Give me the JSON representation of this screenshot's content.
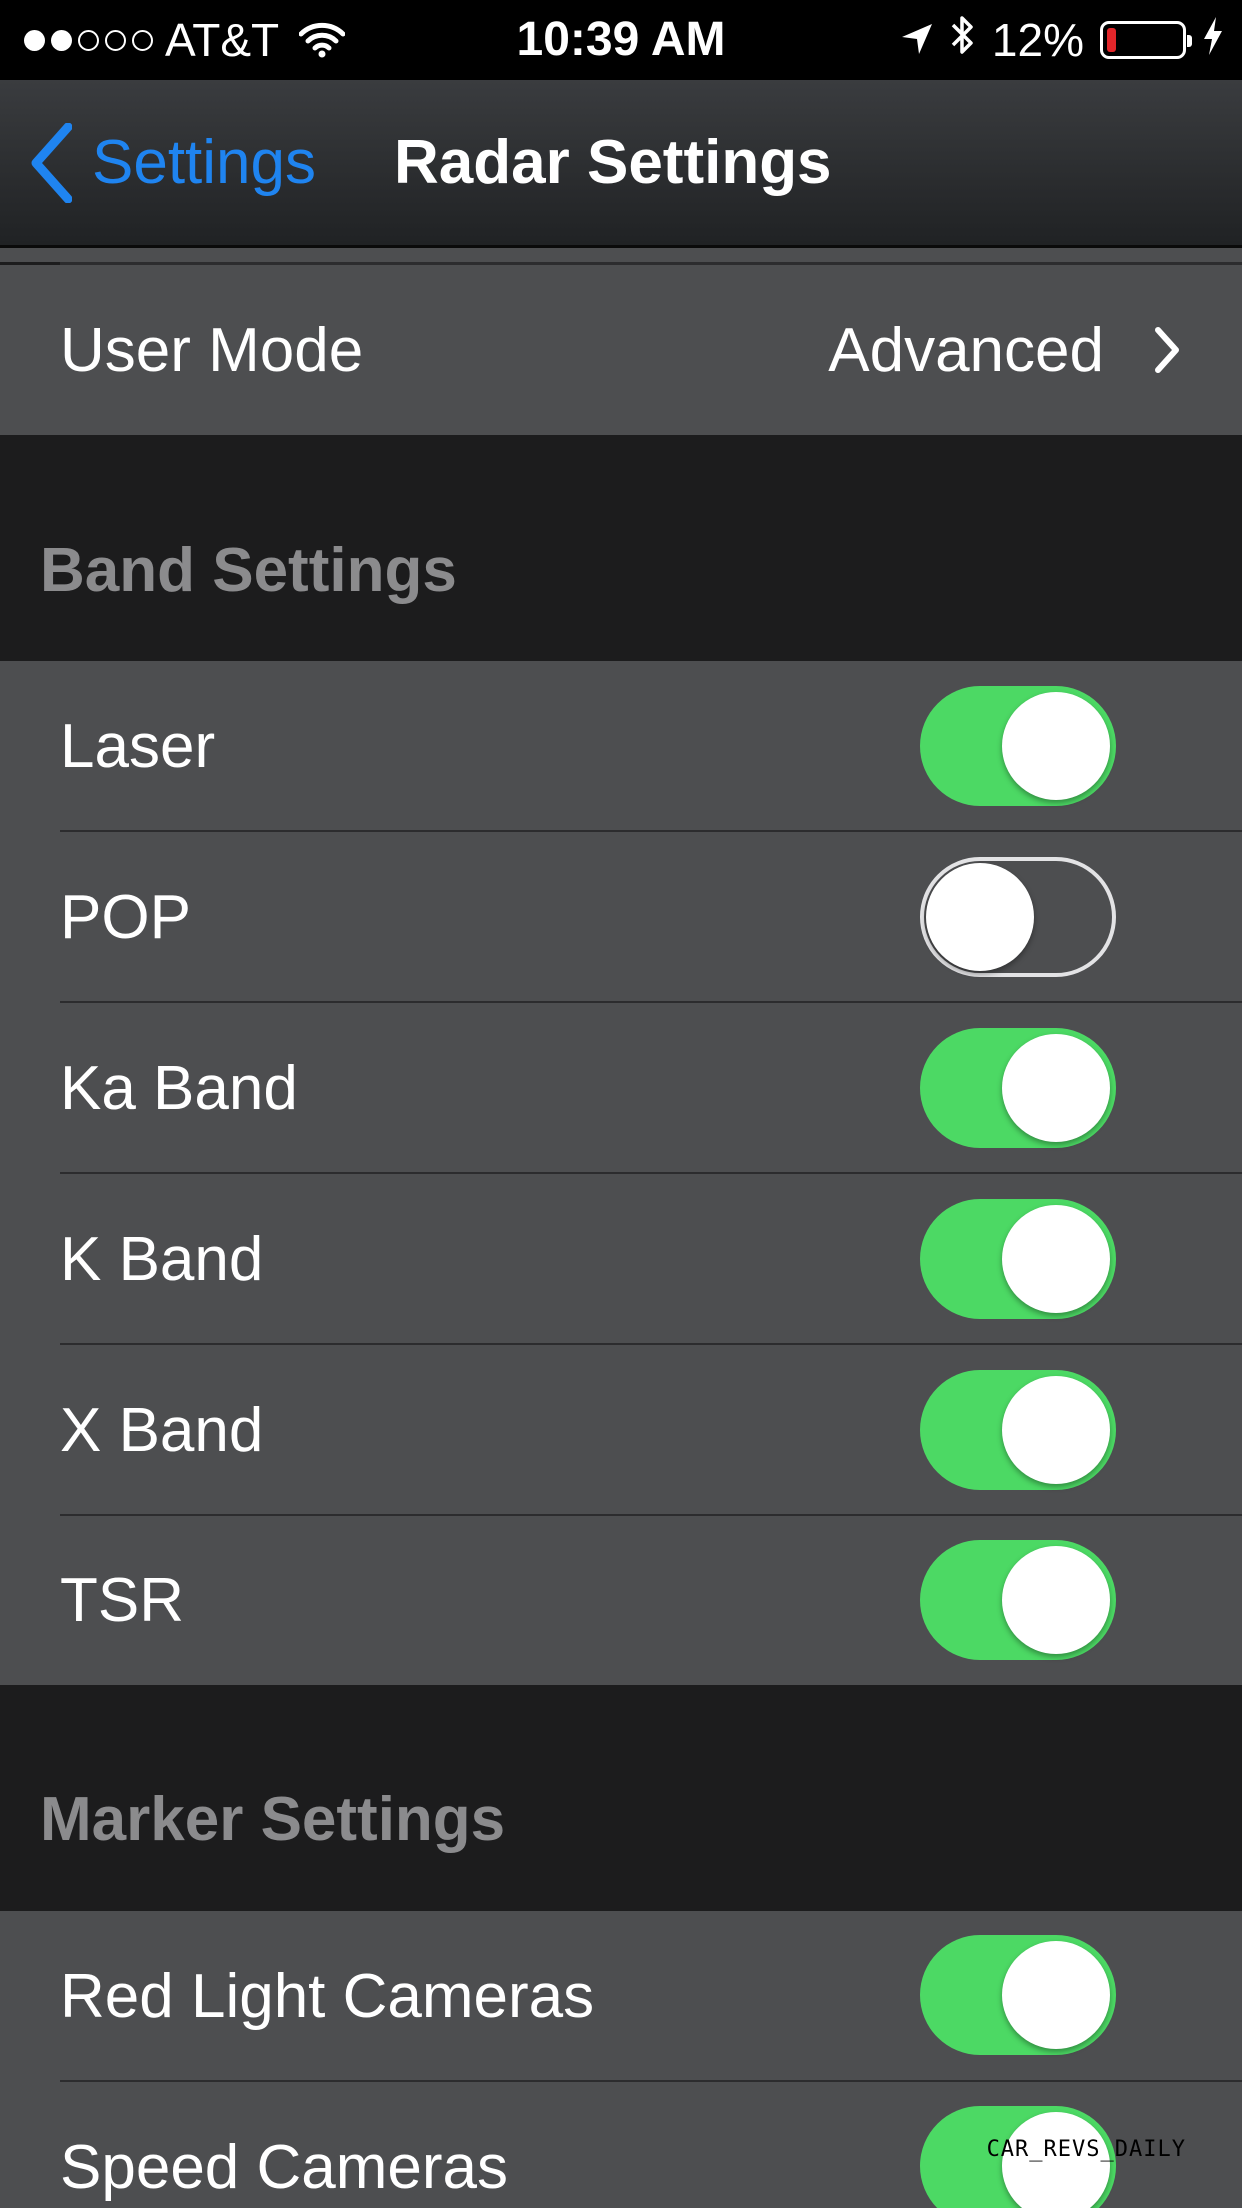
{
  "status_bar": {
    "carrier": "AT&T",
    "time": "10:39 AM",
    "battery": "12%",
    "battery_level": 0.12,
    "signal_bars": 2,
    "icons": [
      "signal-dots-icon",
      "wifi-icon",
      "location-arrow-icon",
      "bluetooth-icon",
      "battery-icon",
      "charging-bolt-icon"
    ]
  },
  "nav": {
    "back_label": "Settings",
    "title": "Radar Settings",
    "back_icon": "chevron-left-icon"
  },
  "user_mode": {
    "label": "User Mode",
    "value": "Advanced",
    "icon": "chevron-right-icon"
  },
  "band_settings": {
    "header": "Band Settings",
    "items": [
      {
        "label": "Laser",
        "on": true
      },
      {
        "label": "POP",
        "on": false
      },
      {
        "label": "Ka Band",
        "on": true
      },
      {
        "label": "K Band",
        "on": true
      },
      {
        "label": "X Band",
        "on": true
      },
      {
        "label": "TSR",
        "on": true
      }
    ]
  },
  "marker_settings": {
    "header": "Marker Settings",
    "items": [
      {
        "label": "Red Light Cameras",
        "on": true
      },
      {
        "label": "Speed Cameras",
        "on": true
      }
    ]
  },
  "colors": {
    "toggle_on": "#4cd964",
    "accent_blue": "#1f84f0",
    "cell_bg": "#4d4e50",
    "group_bg": "#1c1c1d"
  },
  "watermark": "CAR_REVS_DAILY"
}
